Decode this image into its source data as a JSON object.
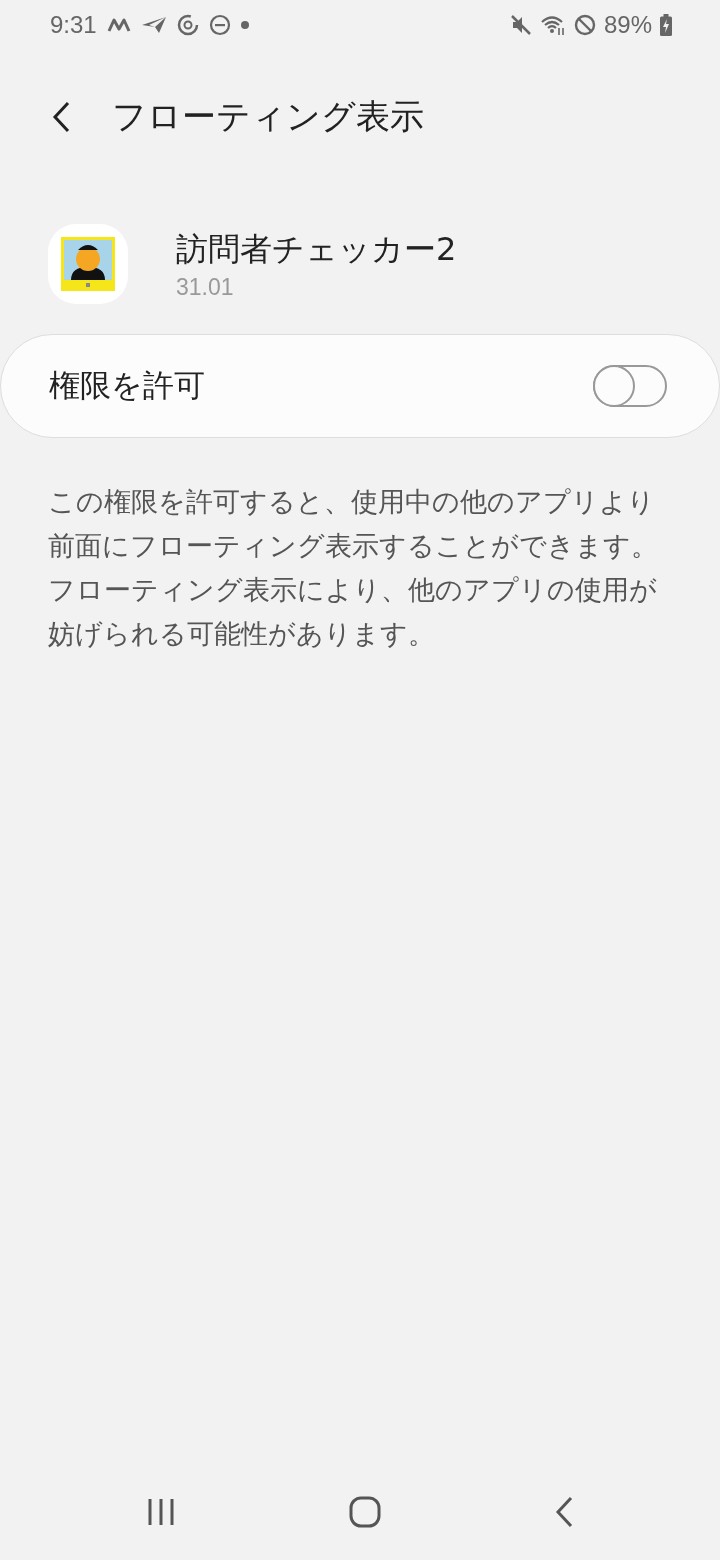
{
  "status_bar": {
    "time": "9:31",
    "battery": "89%"
  },
  "header": {
    "title": "フローティング表示"
  },
  "app": {
    "name": "訪問者チェッカー2",
    "version": "31.01"
  },
  "permission": {
    "label": "権限を許可",
    "on": false
  },
  "description": "この権限を許可すると、使用中の他のアプリより前面にフローティング表示することができます。フローティング表示により、他のアプリの使用が妨げられる可能性があります。"
}
